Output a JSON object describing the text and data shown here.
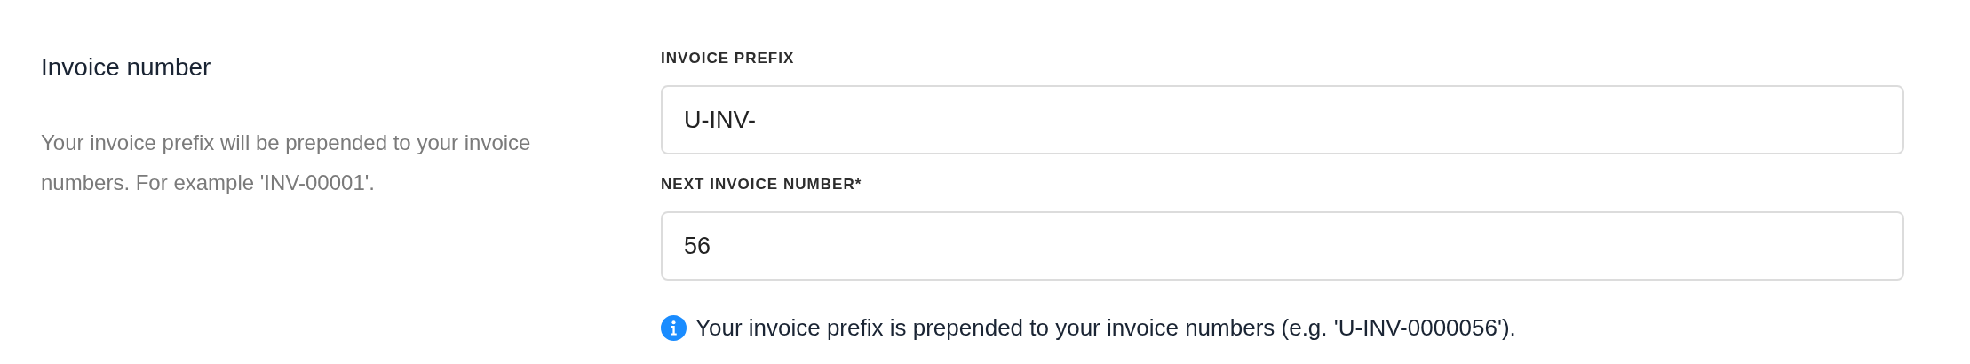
{
  "section": {
    "title": "Invoice number",
    "description": "Your invoice prefix will be prepended to your invoice numbers. For example 'INV-00001'."
  },
  "fields": [
    {
      "label": "INVOICE PREFIX",
      "value": "U-INV-"
    },
    {
      "label": "NEXT INVOICE NUMBER*",
      "value": "56"
    }
  ],
  "help_text": "Your invoice prefix is prepended to your invoice numbers (e.g. 'U-INV-0000056')."
}
